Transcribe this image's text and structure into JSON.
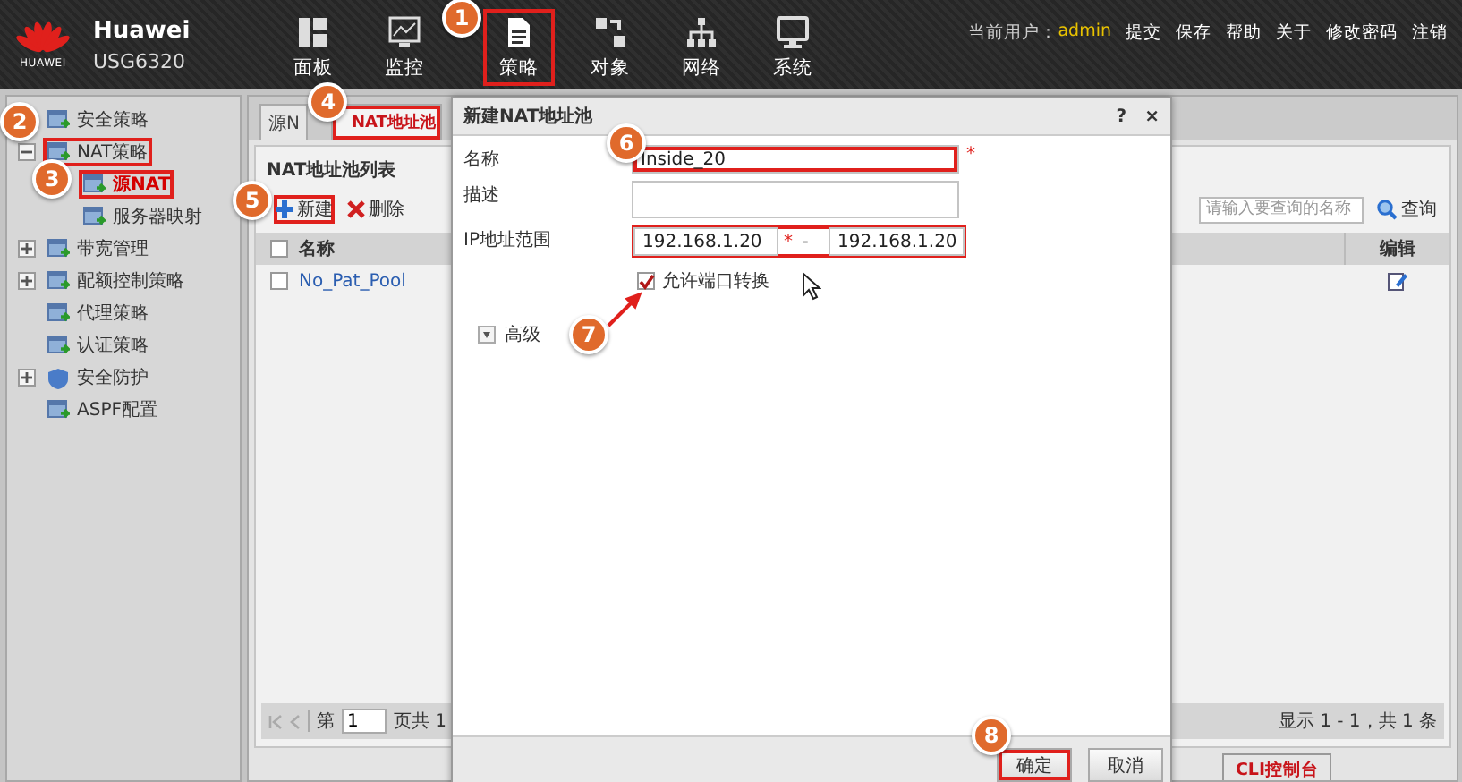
{
  "header": {
    "logo_text": "HUAWEI",
    "name": "Huawei",
    "model": "USG6320",
    "nav": [
      {
        "label": "面板",
        "highlighted": false
      },
      {
        "label": "监控",
        "highlighted": false
      },
      {
        "label": "策略",
        "highlighted": true,
        "annotation": {
          "number": "1",
          "kind": "badge"
        }
      },
      {
        "label": "对象",
        "highlighted": false
      },
      {
        "label": "网络",
        "highlighted": false
      },
      {
        "label": "系统",
        "highlighted": false
      }
    ],
    "user_label": "当前用户：",
    "user": "admin",
    "links": [
      "提交",
      "保存",
      "帮助",
      "关于",
      "修改密码",
      "注销"
    ]
  },
  "sidebar": {
    "items": [
      {
        "label": "安全策略",
        "selected": false,
        "highlighted": false
      },
      {
        "label": "NAT策略",
        "selected": false,
        "expanded": true,
        "highlighted": true,
        "annotation": {
          "number": "2",
          "kind": "badge"
        },
        "children": [
          {
            "label": "源NAT",
            "selected": true,
            "highlighted": true,
            "annotation": {
              "number": "3",
              "kind": "badge"
            }
          },
          {
            "label": "服务器映射",
            "selected": false,
            "highlighted": false
          }
        ]
      },
      {
        "label": "带宽管理",
        "selected": false,
        "expanded": false,
        "highlighted": false
      },
      {
        "label": "配额控制策略",
        "selected": false,
        "expanded": false,
        "highlighted": false
      },
      {
        "label": "代理策略",
        "selected": false,
        "highlighted": false
      },
      {
        "label": "认证策略",
        "selected": false,
        "highlighted": false
      },
      {
        "label": "安全防护",
        "selected": false,
        "expanded": false,
        "highlighted": false
      },
      {
        "label": "ASPF配置",
        "selected": false,
        "highlighted": false
      }
    ]
  },
  "main": {
    "tabs": [
      {
        "label": "源N",
        "selected": false,
        "highlighted": false
      },
      {
        "label": "NAT地址池",
        "selected": true,
        "highlighted": true,
        "annotation": {
          "number": "4",
          "kind": "badge"
        }
      }
    ],
    "list_title": "NAT地址池列表",
    "toolbar": [
      {
        "label": "新建",
        "kind": "add",
        "highlighted": true,
        "annotation": {
          "number": "5",
          "kind": "badge"
        }
      },
      {
        "label": "删除",
        "kind": "delete",
        "highlighted": false
      }
    ],
    "search": {
      "placeholder": "请输入要查询的名称",
      "button": "查询"
    },
    "table": {
      "columns": [
        "名称",
        "编辑"
      ],
      "header_checked": false,
      "rows": [
        {
          "name": "No_Pat_Pool",
          "checked": false
        }
      ]
    },
    "pager": {
      "page_label": "第",
      "page": "1",
      "total_label": "页共 1",
      "summary": "显示 1 - 1，共 1 条"
    },
    "cli_button": "CLI控制台"
  },
  "dialog": {
    "title": "新建NAT地址池",
    "help": "?",
    "close": "×",
    "required_mark": "*",
    "fields": [
      {
        "kind": "text",
        "label": "名称",
        "value": "Inside_20",
        "required": true,
        "highlighted": true,
        "annotation": {
          "number": "6",
          "kind": "badge"
        }
      },
      {
        "kind": "textarea",
        "label": "描述",
        "required": false,
        "highlighted": false
      },
      {
        "kind": "range",
        "label": "IP地址范围",
        "from": "192.168.1.20",
        "separator": "-",
        "to": "192.168.1.20",
        "required": true,
        "highlighted": true
      }
    ],
    "port_translation": {
      "label": "允许端口转换",
      "checked": true,
      "annotation": {
        "number": "7",
        "kind": "arrow"
      }
    },
    "advanced": {
      "label": "高级",
      "expanded": false
    },
    "buttons": [
      {
        "label": "确定",
        "highlighted": true,
        "annotation": {
          "number": "8",
          "kind": "badge"
        }
      },
      {
        "label": "取消",
        "highlighted": false
      }
    ]
  }
}
